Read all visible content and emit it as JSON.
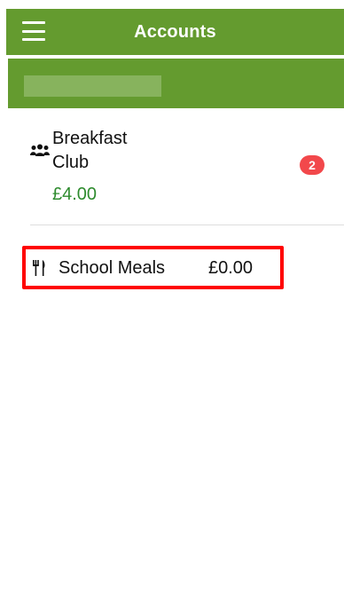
{
  "header": {
    "title": "Accounts",
    "menu_icon": "menu-icon",
    "color": "#649b2f"
  },
  "subheader": {
    "name": "",
    "note": "redacted",
    "color": "#649b2f"
  },
  "accounts": [
    {
      "name": "Breakfast Club",
      "amount": "£4.00",
      "icon": "group-icon",
      "badge": "2",
      "amount_color": "#2e8b2e",
      "badge_color": "#f2484b"
    },
    {
      "name": "School Meals",
      "amount": "£0.00",
      "icon": "cutlery-icon",
      "highlight_color": "#ff0000"
    }
  ]
}
